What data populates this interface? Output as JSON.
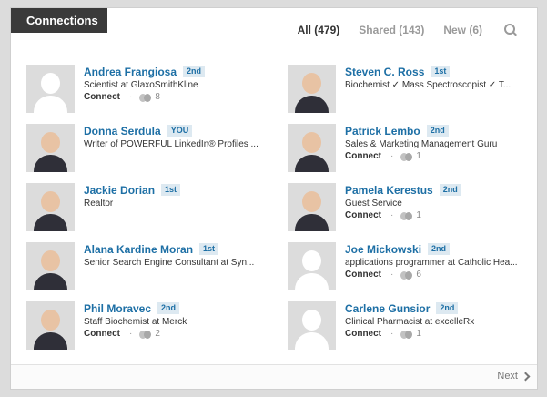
{
  "header": {
    "title": "Connections"
  },
  "filters": [
    {
      "label": "All (479)",
      "active": true
    },
    {
      "label": "Shared (143)",
      "active": false
    },
    {
      "label": "New (6)",
      "active": false
    }
  ],
  "icons": {
    "search": "search-icon",
    "shared": "shared-connections-icon",
    "next": "chevron-right-icon"
  },
  "connections": [
    {
      "name": "Andrea Frangiosa",
      "degree": "2nd",
      "headline": "Scientist at GlaxoSmithKline",
      "connect_label": "Connect",
      "shared_count": "8",
      "has_photo": false
    },
    {
      "name": "Steven C. Ross",
      "degree": "1st",
      "headline": "Biochemist ✓ Mass Spectroscopist ✓ T...",
      "connect_label": "",
      "shared_count": "",
      "has_photo": true
    },
    {
      "name": "Donna Serdula",
      "degree": "YOU",
      "headline": "Writer of POWERFUL LinkedIn® Profiles ...",
      "connect_label": "",
      "shared_count": "",
      "has_photo": true
    },
    {
      "name": "Patrick Lembo",
      "degree": "2nd",
      "headline": "Sales & Marketing Management Guru",
      "connect_label": "Connect",
      "shared_count": "1",
      "has_photo": true
    },
    {
      "name": "Jackie Dorian",
      "degree": "1st",
      "headline": "Realtor",
      "connect_label": "",
      "shared_count": "",
      "has_photo": true
    },
    {
      "name": "Pamela Kerestus",
      "degree": "2nd",
      "headline": "Guest Service",
      "connect_label": "Connect",
      "shared_count": "1",
      "has_photo": true
    },
    {
      "name": "Alana Kardine Moran",
      "degree": "1st",
      "headline": "Senior Search Engine Consultant at Syn...",
      "connect_label": "",
      "shared_count": "",
      "has_photo": true
    },
    {
      "name": "Joe Mickowski",
      "degree": "2nd",
      "headline": "applications programmer at Catholic Hea...",
      "connect_label": "Connect",
      "shared_count": "6",
      "has_photo": false
    },
    {
      "name": "Phil Moravec",
      "degree": "2nd",
      "headline": "Staff Biochemist at Merck",
      "connect_label": "Connect",
      "shared_count": "2",
      "has_photo": true
    },
    {
      "name": "Carlene Gunsior",
      "degree": "2nd",
      "headline": "Clinical Pharmacist at excelleRx",
      "connect_label": "Connect",
      "shared_count": "1",
      "has_photo": false
    }
  ],
  "footer": {
    "next_label": "Next"
  },
  "colors": {
    "link": "#1d6fa5",
    "tab_bg": "#3a3a3a",
    "badge_bg": "#dde9f1"
  }
}
